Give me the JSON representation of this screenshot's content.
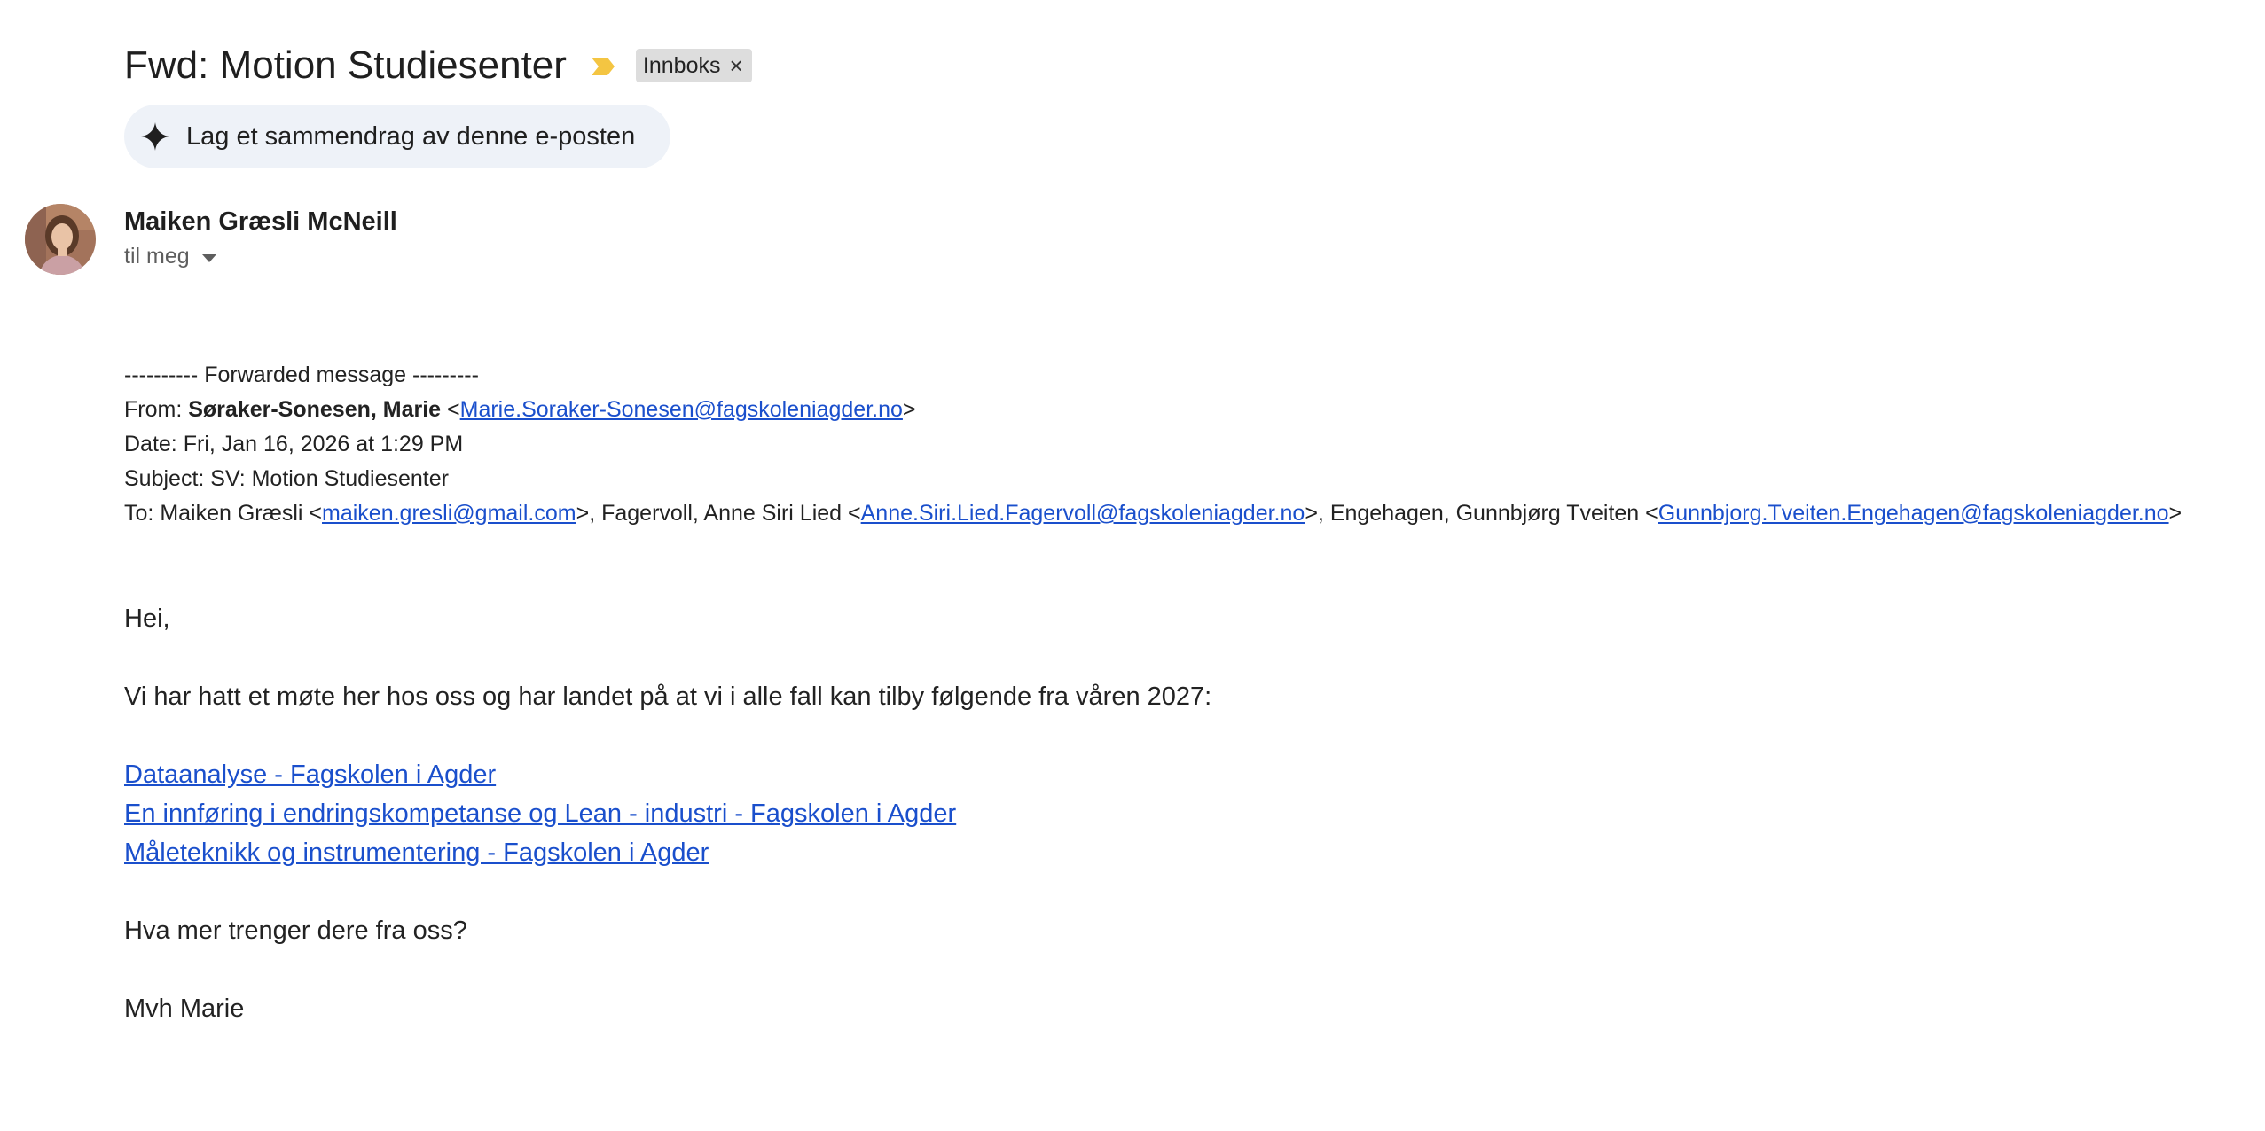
{
  "header": {
    "subject": "Fwd: Motion Studiesenter",
    "label_chip": "Innboks",
    "label_chip_close": "×",
    "important_marker_color": "#f4c542"
  },
  "summary_button": {
    "label": "Lag et sammendrag av denne e-posten",
    "icon": "sparkle-icon"
  },
  "sender": {
    "name": "Maiken Græsli McNeill",
    "recipient_summary": "til meg"
  },
  "forwarded": {
    "separator": "---------- Forwarded message ---------",
    "from_label": "From:",
    "from_name": "Søraker-Sonesen, Marie",
    "from_email": "Marie.Soraker-Sonesen@fagskoleniagder.no",
    "date_label": "Date:",
    "date_value": "Fri, Jan 16, 2026 at 1:29 PM",
    "subject_label": "Subject:",
    "subject_value": "SV: Motion Studiesenter",
    "to_label": "To:",
    "to": [
      {
        "name": "Maiken Græsli",
        "email": "maiken.gresli@gmail.com"
      },
      {
        "name": "Fagervoll, Anne Siri Lied",
        "email": "Anne.Siri.Lied.Fagervoll@fagskoleniagder.no"
      },
      {
        "name": "Engehagen, Gunnbjørg Tveiten",
        "email": "Gunnbjorg.Tveiten.Engehagen@fagskoleniagder.no"
      }
    ]
  },
  "message": {
    "greeting": "Hei,",
    "intro": "Vi har hatt et møte her hos oss og har landet på at vi i alle fall kan tilby følgende fra våren 2027:",
    "links": [
      "Dataanalyse - Fagskolen i Agder",
      "En innføring i endringskompetanse og Lean - industri - Fagskolen i Agder",
      "Måleteknikk og instrumentering - Fagskolen i Agder"
    ],
    "question": "Hva mer trenger dere fra oss?",
    "signoff": "Mvh Marie"
  },
  "colors": {
    "link": "#1a4fcc",
    "summary_bg": "#eef2f8",
    "chip_bg": "#dddddd"
  }
}
